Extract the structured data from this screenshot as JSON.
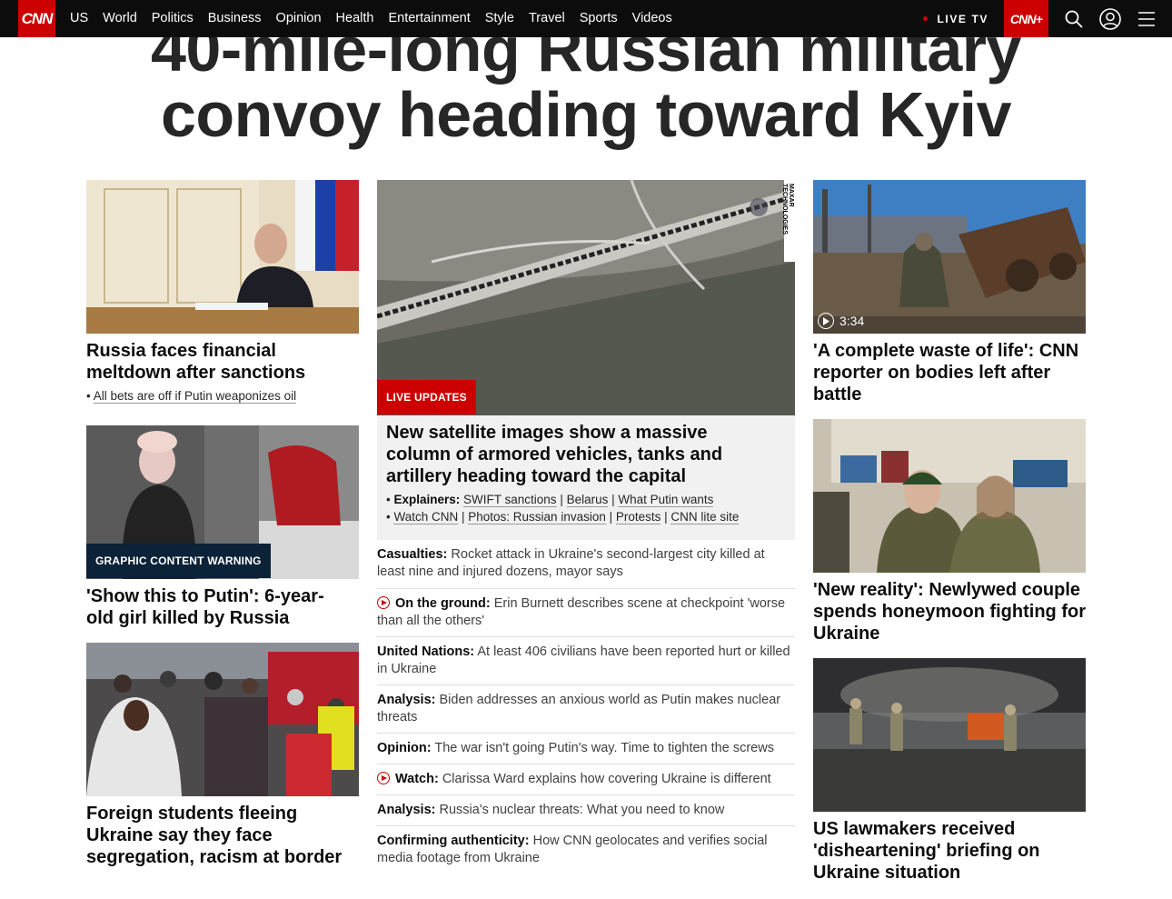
{
  "nav": {
    "logo": "CNN",
    "links": [
      "US",
      "World",
      "Politics",
      "Business",
      "Opinion",
      "Health",
      "Entertainment",
      "Style",
      "Travel",
      "Sports",
      "Videos"
    ],
    "live_tv": "LIVE TV",
    "cnn_plus": "CNN+",
    "icons": [
      "search-icon",
      "account-icon",
      "menu-icon"
    ]
  },
  "headline": {
    "line1": "40-mile-long Russian military",
    "line2": "convoy heading toward Kyiv"
  },
  "left": {
    "card1": {
      "title": "Russia faces financial meltdown after sanctions",
      "sublink": "All bets are off if Putin weaponizes oil"
    },
    "card2": {
      "badge": "GRAPHIC CONTENT WARNING",
      "title": "'Show this to Putin': 6-year-old girl killed by Russia"
    },
    "card3": {
      "title": "Foreign students fleeing Ukraine say they face segregation, racism at border"
    }
  },
  "center": {
    "badge": "LIVE UPDATES",
    "credit": "MAXAR TECHNOLOGIES",
    "lead_title": "New satellite images show a massive column of armored vehicles, tanks and artillery heading toward the capital",
    "explainers_label": "Explainers:",
    "explainers": [
      "SWIFT sanctions",
      "Belarus",
      "What Putin wants"
    ],
    "watch_links": [
      "Watch CNN",
      "Photos: Russian invasion",
      "Protests",
      "CNN lite site"
    ],
    "stories": [
      {
        "label": "Casualties:",
        "text": "Rocket attack in Ukraine's second-largest city killed at least nine and injured dozens, mayor says",
        "video": false
      },
      {
        "label": "On the ground:",
        "text": "Erin Burnett describes scene at checkpoint 'worse than all the others'",
        "video": true
      },
      {
        "label": "United Nations:",
        "text": "At least 406 civilians have been reported hurt or killed in Ukraine",
        "video": false
      },
      {
        "label": "Analysis:",
        "text": "Biden addresses an anxious world as Putin makes nuclear threats",
        "video": false
      },
      {
        "label": "Opinion:",
        "text": "The war isn't going Putin's way. Time to tighten the screws",
        "video": false
      },
      {
        "label": "Watch:",
        "text": "Clarissa Ward explains how covering Ukraine is different",
        "video": true
      },
      {
        "label": "Analysis:",
        "text": "Russia's nuclear threats: What you need to know",
        "video": false
      },
      {
        "label": "Confirming authenticity:",
        "text": "How CNN geolocates and verifies social media footage from Ukraine",
        "video": false
      }
    ]
  },
  "right": {
    "card1": {
      "duration": "3:34",
      "title": "'A complete waste of life': CNN reporter on bodies left after battle"
    },
    "card2": {
      "title": "'New reality': Newlywed couple spends honeymoon fighting for Ukraine"
    },
    "card3": {
      "title": "US lawmakers received 'disheartening' briefing on Ukraine situation"
    }
  },
  "colors": {
    "brand_red": "#cc0000",
    "nav_bg": "#0c0c0c",
    "badge_dark": "#0b2238"
  }
}
